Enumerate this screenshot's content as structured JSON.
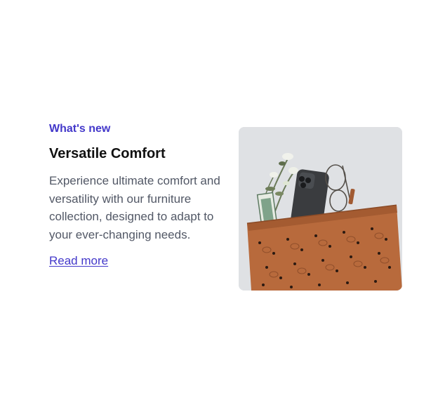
{
  "card": {
    "eyebrow": "What's new",
    "title": "Versatile Comfort",
    "description": "Experience ultimate comfort and versatility with our furniture collection, designed to adapt to your ever-changing needs.",
    "link_label": "Read more"
  },
  "image": {
    "subject": "leather pouch with phone, glasses and flowers",
    "colors": {
      "background": "#dfe1e4",
      "leather": "#b86a3c",
      "accent": "#4338ca"
    }
  }
}
